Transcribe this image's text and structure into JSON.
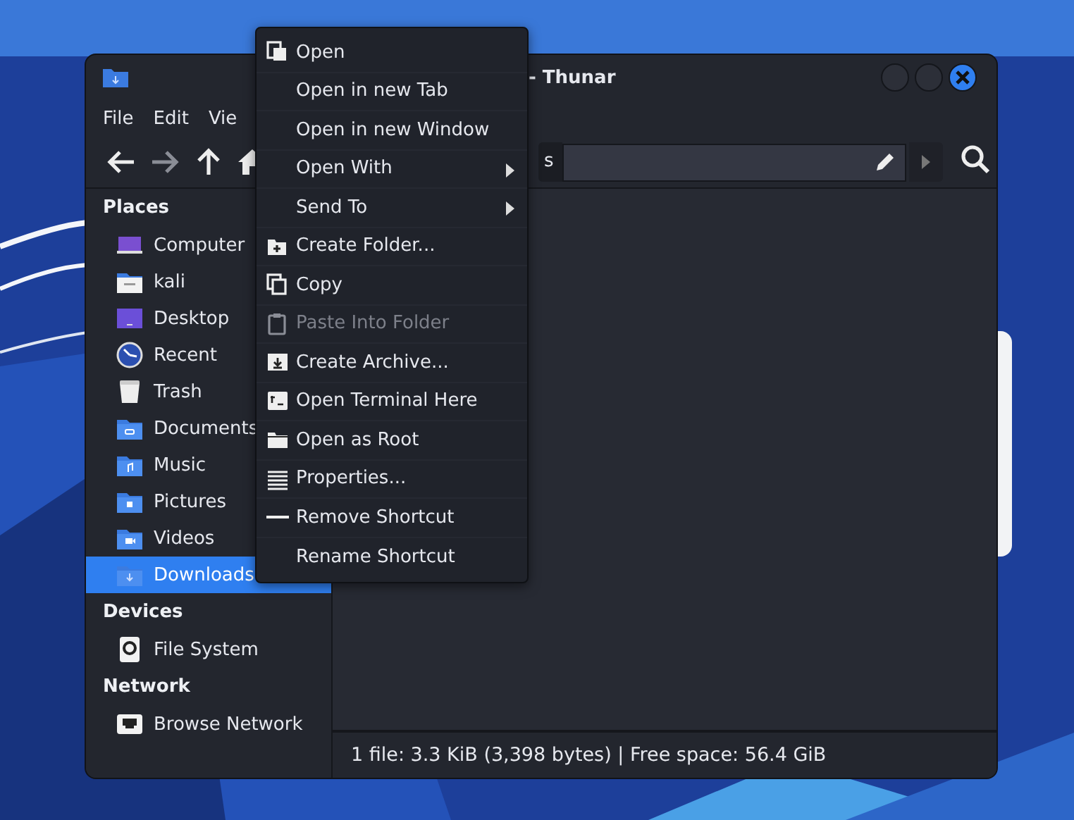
{
  "window": {
    "title": "- Thunar"
  },
  "menu_bar": [
    "File",
    "Edit",
    "Vie"
  ],
  "toolbar": {
    "buttons": [
      {
        "disabled": false
      },
      {
        "disabled": true
      },
      {
        "disabled": false
      },
      {
        "disabled": false
      }
    ]
  },
  "location_bar": {
    "path_button": "s"
  },
  "sidebar": {
    "sections": [
      {
        "heading": "Places",
        "items": [
          {
            "label": "Computer",
            "selected": false
          },
          {
            "label": "kali",
            "selected": false
          },
          {
            "label": "Desktop",
            "selected": false
          },
          {
            "label": "Recent",
            "selected": false
          },
          {
            "label": "Trash",
            "selected": false
          },
          {
            "label": "Documents",
            "selected": false
          },
          {
            "label": "Music",
            "selected": false
          },
          {
            "label": "Pictures",
            "selected": false
          },
          {
            "label": "Videos",
            "selected": false
          },
          {
            "label": "Downloads",
            "selected": true
          }
        ]
      },
      {
        "heading": "Devices",
        "items": [
          {
            "label": "File System",
            "selected": false
          }
        ]
      },
      {
        "heading": "Network",
        "items": [
          {
            "label": "Browse Network",
            "selected": false
          }
        ]
      }
    ]
  },
  "status_bar": "1 file: 3.3 KiB (3,398 bytes) | Free space: 56.4 GiB",
  "context_menu": {
    "items": [
      {
        "label": "Open",
        "disabled": false,
        "submenu": false
      },
      {
        "label": "Open in new Tab",
        "disabled": false,
        "submenu": false
      },
      {
        "label": "Open in new Window",
        "disabled": false,
        "submenu": false
      },
      {
        "label": "Open With",
        "disabled": false,
        "submenu": true
      },
      {
        "label": "Send To",
        "disabled": false,
        "submenu": true
      },
      {
        "label": "Create Folder...",
        "disabled": false,
        "submenu": false
      },
      {
        "label": "Copy",
        "disabled": false,
        "submenu": false
      },
      {
        "label": "Paste Into Folder",
        "disabled": true,
        "submenu": false
      },
      {
        "label": "Create Archive...",
        "disabled": false,
        "submenu": false
      },
      {
        "label": "Open Terminal Here",
        "disabled": false,
        "submenu": false
      },
      {
        "label": "Open as Root",
        "disabled": false,
        "submenu": false
      },
      {
        "label": "Properties...",
        "disabled": false,
        "submenu": false
      },
      {
        "label": "Remove Shortcut",
        "disabled": false,
        "submenu": false
      },
      {
        "label": "Rename Shortcut",
        "disabled": false,
        "submenu": false
      }
    ]
  }
}
